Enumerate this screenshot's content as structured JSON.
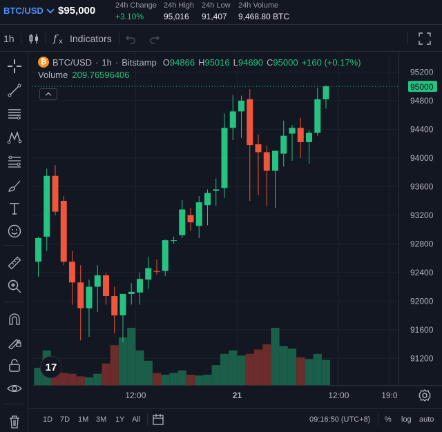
{
  "ticker": {
    "pair": "BTC/USD",
    "price": "$95,000",
    "stats": [
      {
        "label": "24h Change",
        "value": "+3.10%",
        "positive": true
      },
      {
        "label": "24h High",
        "value": "95,016",
        "positive": false
      },
      {
        "label": "24h Low",
        "value": "91,407",
        "positive": false
      },
      {
        "label": "24h Volume",
        "value": "9,468.80 BTC",
        "positive": false
      }
    ]
  },
  "toolbar": {
    "interval": "1h",
    "indicators_label": "Indicators"
  },
  "legend": {
    "symbol": "BTC/USD",
    "sep1": "·",
    "interval": "1h",
    "sep2": "·",
    "exchange": "Bitstamp",
    "o_label": "O",
    "o_value": "94866",
    "h_label": "H",
    "h_value": "95016",
    "l_label": "L",
    "l_value": "94690",
    "c_label": "C",
    "c_value": "95000",
    "change": "+160 (+0.17%)",
    "volume_label": "Volume",
    "volume_value": "209.76596406",
    "coin_glyph": "₿"
  },
  "logo_text": "17",
  "bottombar": {
    "ranges": [
      "1D",
      "7D",
      "1M",
      "3M",
      "1Y",
      "All"
    ],
    "time": "09:16:50 (UTC+8)",
    "percent": "%",
    "log": "log",
    "auto": "auto"
  },
  "colors": {
    "up": "#26c281",
    "down": "#f0563d",
    "vol_up": "#1a5e49",
    "vol_down": "#6b2c2b",
    "accent": "#4f8ef7"
  },
  "chart_data": {
    "type": "candlestick",
    "ylim": [
      91000,
      95300
    ],
    "y_ticks": [
      95200,
      94800,
      94400,
      94000,
      93600,
      93200,
      92800,
      92400,
      92000,
      91600,
      91200
    ],
    "last_price_label": "95000",
    "last_price": 95000,
    "x_ticks": [
      {
        "index": 11.5,
        "label": "12:00"
      },
      {
        "index": 23.5,
        "label": "21"
      },
      {
        "index": 35.5,
        "label": "12:00"
      },
      {
        "index": 41.5,
        "label": "19:0"
      }
    ],
    "candles": [
      {
        "o": 92550,
        "h": 92900,
        "l": 92340,
        "c": 92880
      },
      {
        "o": 92900,
        "h": 93850,
        "l": 92700,
        "c": 93750
      },
      {
        "o": 93750,
        "h": 93900,
        "l": 93200,
        "c": 93250
      },
      {
        "o": 93400,
        "h": 93470,
        "l": 92500,
        "c": 92550
      },
      {
        "o": 92550,
        "h": 92700,
        "l": 91950,
        "c": 92260
      },
      {
        "o": 92260,
        "h": 92500,
        "l": 91450,
        "c": 91900
      },
      {
        "o": 91900,
        "h": 92300,
        "l": 91500,
        "c": 92200
      },
      {
        "o": 92200,
        "h": 92500,
        "l": 91850,
        "c": 92360
      },
      {
        "o": 92360,
        "h": 92390,
        "l": 91950,
        "c": 92070
      },
      {
        "o": 92070,
        "h": 92200,
        "l": 91550,
        "c": 91800
      },
      {
        "o": 91800,
        "h": 92100,
        "l": 91420,
        "c": 92100
      },
      {
        "o": 92100,
        "h": 92250,
        "l": 91950,
        "c": 92130
      },
      {
        "o": 92120,
        "h": 92400,
        "l": 91950,
        "c": 92310
      },
      {
        "o": 92300,
        "h": 92620,
        "l": 92170,
        "c": 92460
      },
      {
        "o": 92420,
        "h": 92580,
        "l": 92370,
        "c": 92410
      },
      {
        "o": 92420,
        "h": 92860,
        "l": 92350,
        "c": 92850
      },
      {
        "o": 92850,
        "h": 92900,
        "l": 92800,
        "c": 92850
      },
      {
        "o": 92920,
        "h": 93410,
        "l": 92880,
        "c": 93280
      },
      {
        "o": 93200,
        "h": 93300,
        "l": 92980,
        "c": 93100
      },
      {
        "o": 93050,
        "h": 93470,
        "l": 92880,
        "c": 93380
      },
      {
        "o": 93340,
        "h": 93560,
        "l": 93060,
        "c": 93510
      },
      {
        "o": 93540,
        "h": 93710,
        "l": 93330,
        "c": 93560
      },
      {
        "o": 93580,
        "h": 94620,
        "l": 93440,
        "c": 94420
      },
      {
        "o": 94420,
        "h": 94880,
        "l": 94250,
        "c": 94650
      },
      {
        "o": 94650,
        "h": 94870,
        "l": 94280,
        "c": 94800
      },
      {
        "o": 94820,
        "h": 94960,
        "l": 93400,
        "c": 94180
      },
      {
        "o": 94190,
        "h": 94330,
        "l": 93480,
        "c": 94080
      },
      {
        "o": 94080,
        "h": 94170,
        "l": 93330,
        "c": 93820
      },
      {
        "o": 93820,
        "h": 94050,
        "l": 93300,
        "c": 94100
      },
      {
        "o": 94060,
        "h": 94520,
        "l": 93880,
        "c": 94310
      },
      {
        "o": 94340,
        "h": 94460,
        "l": 93960,
        "c": 94420
      },
      {
        "o": 94420,
        "h": 94560,
        "l": 94000,
        "c": 94220
      },
      {
        "o": 94220,
        "h": 94390,
        "l": 93920,
        "c": 94350
      },
      {
        "o": 94350,
        "h": 94980,
        "l": 94310,
        "c": 94820
      },
      {
        "o": 94820,
        "h": 95016,
        "l": 94690,
        "c": 95000
      }
    ],
    "volume": [
      20,
      40,
      18,
      14,
      13,
      10,
      9,
      13,
      25,
      46,
      55,
      66,
      40,
      28,
      14,
      12,
      14,
      17,
      12,
      11,
      12,
      23,
      36,
      40,
      34,
      36,
      41,
      47,
      66,
      45,
      42,
      32,
      30,
      36,
      29
    ]
  }
}
